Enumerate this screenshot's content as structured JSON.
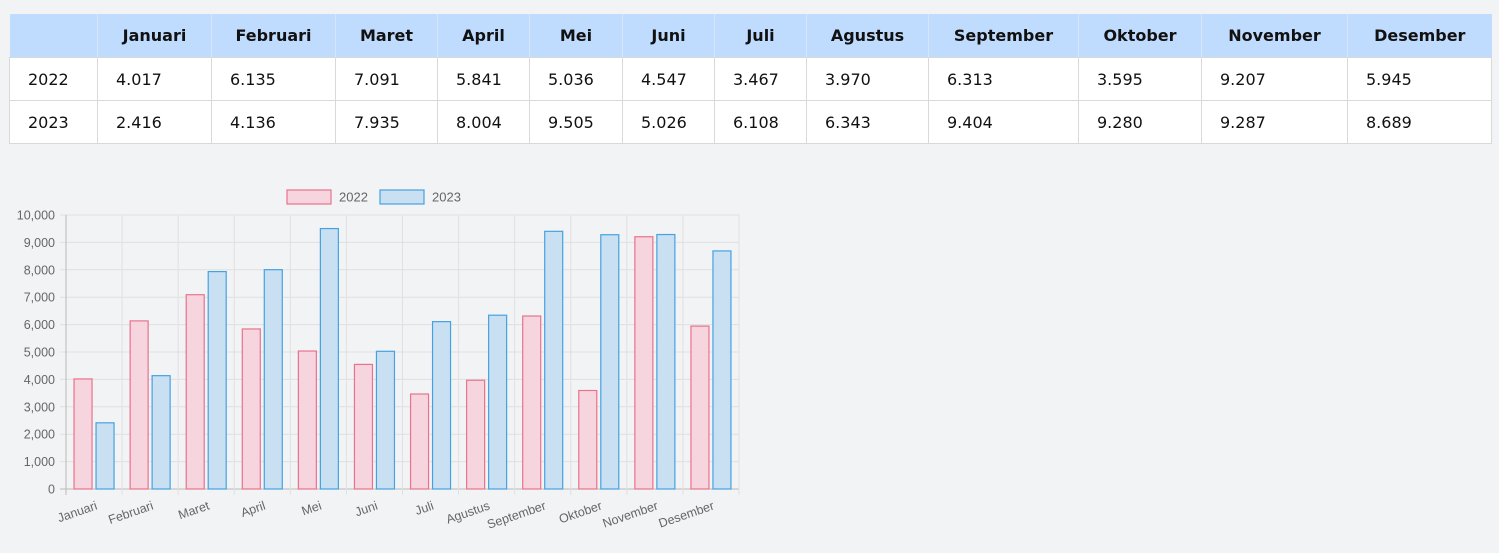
{
  "table": {
    "header": [
      "",
      "Januari",
      "Februari",
      "Maret",
      "April",
      "Mei",
      "Juni",
      "Juli",
      "Agustus",
      "September",
      "Oktober",
      "November",
      "Desember"
    ],
    "rows": [
      [
        "2022",
        "4.017",
        "6.135",
        "7.091",
        "5.841",
        "5.036",
        "4.547",
        "3.467",
        "3.970",
        "6.313",
        "3.595",
        "9.207",
        "5.945"
      ],
      [
        "2023",
        "2.416",
        "4.136",
        "7.935",
        "8.004",
        "9.505",
        "5.026",
        "6.108",
        "6.343",
        "9.404",
        "9.280",
        "9.287",
        "8.689"
      ]
    ]
  },
  "chart_data": {
    "type": "bar",
    "categories": [
      "Januari",
      "Februari",
      "Maret",
      "April",
      "Mei",
      "Juni",
      "Juli",
      "Agustus",
      "September",
      "Oktober",
      "November",
      "Desember"
    ],
    "series": [
      {
        "name": "2022",
        "values": [
          4017,
          6135,
          7091,
          5841,
          5036,
          4547,
          3467,
          3970,
          6313,
          3595,
          9207,
          5945
        ],
        "fill": "#f7d5de",
        "stroke": "#e9728d"
      },
      {
        "name": "2023",
        "values": [
          2416,
          4136,
          7935,
          8004,
          9505,
          5026,
          6108,
          6343,
          9404,
          9280,
          9287,
          8689
        ],
        "fill": "#c9e0f3",
        "stroke": "#45a2e0"
      }
    ],
    "ylim": [
      0,
      10000
    ],
    "yticks": [
      "0",
      "1,000",
      "2,000",
      "3,000",
      "4,000",
      "5,000",
      "6,000",
      "7,000",
      "8,000",
      "9,000",
      "10,000"
    ],
    "grid": true,
    "legend_position": "top"
  }
}
